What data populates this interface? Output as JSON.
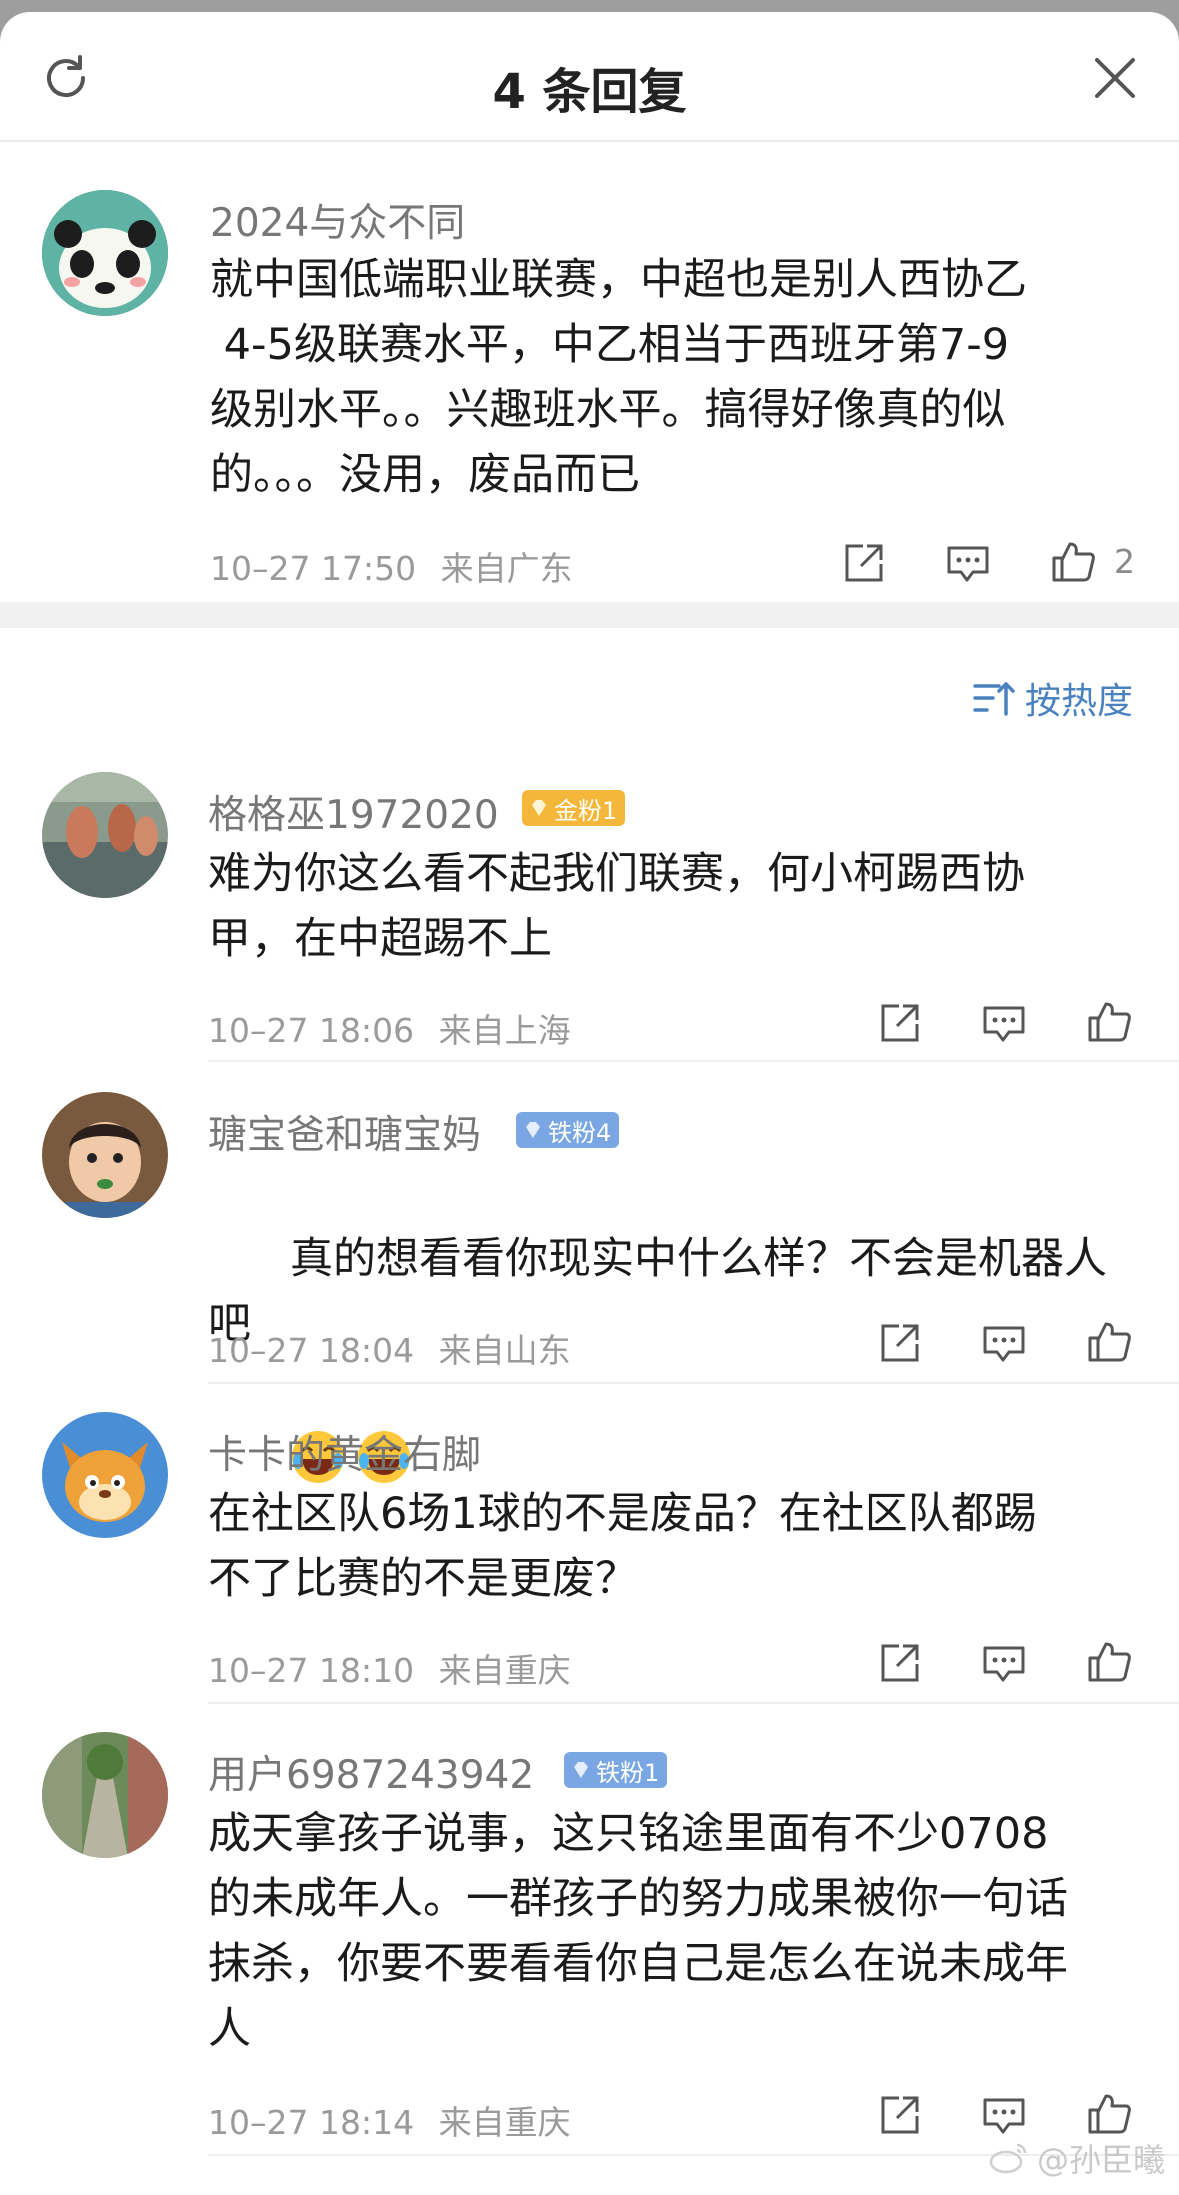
{
  "header": {
    "title": "4 条回复"
  },
  "original": {
    "username": "2024与众不同",
    "text": "就中国低端职业联赛，中超也是别人西协乙\n 4-5级联赛水平，中乙相当于西班牙第7-9\n级别水平。。兴趣班水平。搞得好像真的似\n的。。。没用，废品而已",
    "time": "10–27 17:50",
    "location": "来自广东",
    "likes": "2"
  },
  "sort": {
    "label": "按热度"
  },
  "replies": [
    {
      "username": "格格巫1972020",
      "badge": "金粉1",
      "text": "难为你这么看不起我们联赛，何小柯踢西协\n甲，在中超踢不上",
      "time": "10–27 18:06",
      "location": "来自上海"
    },
    {
      "username": "瑭宝爸和瑭宝妈",
      "badge": "铁粉4",
      "text": "真的想看看你现实中什么样？不会是机器人吧",
      "time": "10–27 18:04",
      "location": "来自山东"
    },
    {
      "username": "卡卡的黄金右脚",
      "text": "在社区队6场1球的不是废品？在社区队都踢\n不了比赛的不是更废？",
      "time": "10–27 18:10",
      "location": "来自重庆"
    },
    {
      "username": "用户6987243942",
      "badge": "铁粉1",
      "text": "成天拿孩子说事，这只铭途里面有不少0708\n的未成年人。一群孩子的努力成果被你一句话\n抹杀，你要不要看看你自己是怎么在说未成年\n人",
      "time": "10–27 18:14",
      "location": "来自重庆"
    }
  ],
  "watermark": "@孙臣曦",
  "colors": {
    "accent": "#4a82c0",
    "gold_badge": "#f5b739",
    "iron_badge": "#7aa7e4"
  },
  "icons": [
    "refresh-icon",
    "close-icon",
    "share-icon",
    "comment-icon",
    "like-icon",
    "sort-icon",
    "laugh-emoji-icon",
    "weibo-logo-icon"
  ]
}
